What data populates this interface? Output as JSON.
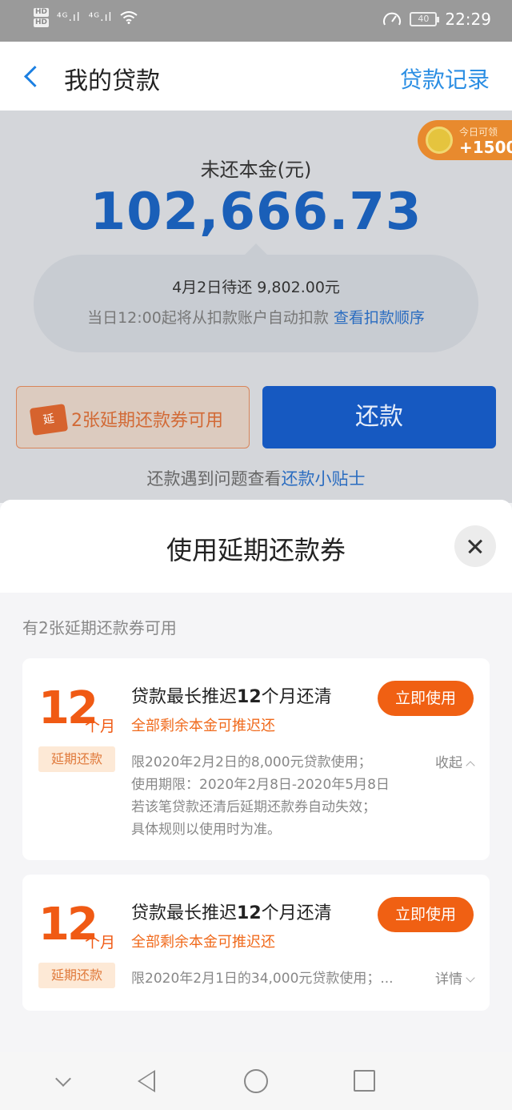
{
  "status_bar": {
    "hd1": "HD",
    "hd2": "HD",
    "signal1": "⁴ᴳ.ıl",
    "signal2": "⁴ᴳ.ıl",
    "battery": "40",
    "time": "22:29"
  },
  "header": {
    "title": "我的贷款",
    "records_link": "贷款记录"
  },
  "promo": {
    "line1": "今日可领",
    "line2": "+1500"
  },
  "summary": {
    "principal_label": "未还本金(元)",
    "principal_amount": "102,666.73",
    "due_text": "4月2日待还 9,802.00元",
    "auto_text": "当日12:00起将从扣款账户自动扣款",
    "order_link": "查看扣款顺序"
  },
  "actions": {
    "coupon_icon_text": "延",
    "coupon_label": "2张延期还款券可用",
    "repay_label": "还款",
    "tips_text": "还款遇到问题查看",
    "tips_link": "还款小贴士"
  },
  "sheet": {
    "title": "使用延期还款券",
    "available_text": "有2张延期还款券可用",
    "coupons": [
      {
        "number": "12",
        "unit": "个月",
        "tag": "延期还款",
        "title_pre": "贷款最长推迟",
        "title_bold": "12",
        "title_post": "个月还清",
        "subtitle": "全部剩余本金可推迟还",
        "button": "立即使用",
        "toggle": "收起",
        "desc": [
          "限2020年2月2日的8,000元贷款使用；",
          "使用期限：2020年2月8日-2020年5月8日",
          "若该笔贷款还清后延期还款券自动失效；",
          "具体规则以使用时为准。"
        ]
      },
      {
        "number": "12",
        "unit": "个月",
        "tag": "延期还款",
        "title_pre": "贷款最长推迟",
        "title_bold": "12",
        "title_post": "个月还清",
        "subtitle": "全部剩余本金可推迟还",
        "button": "立即使用",
        "toggle": "详情",
        "desc": [
          "限2020年2月1日的34,000元贷款使用；..."
        ]
      }
    ]
  },
  "colors": {
    "brand_blue": "#1659c1",
    "accent_orange": "#f06013",
    "link_blue": "#2b8ee3"
  }
}
